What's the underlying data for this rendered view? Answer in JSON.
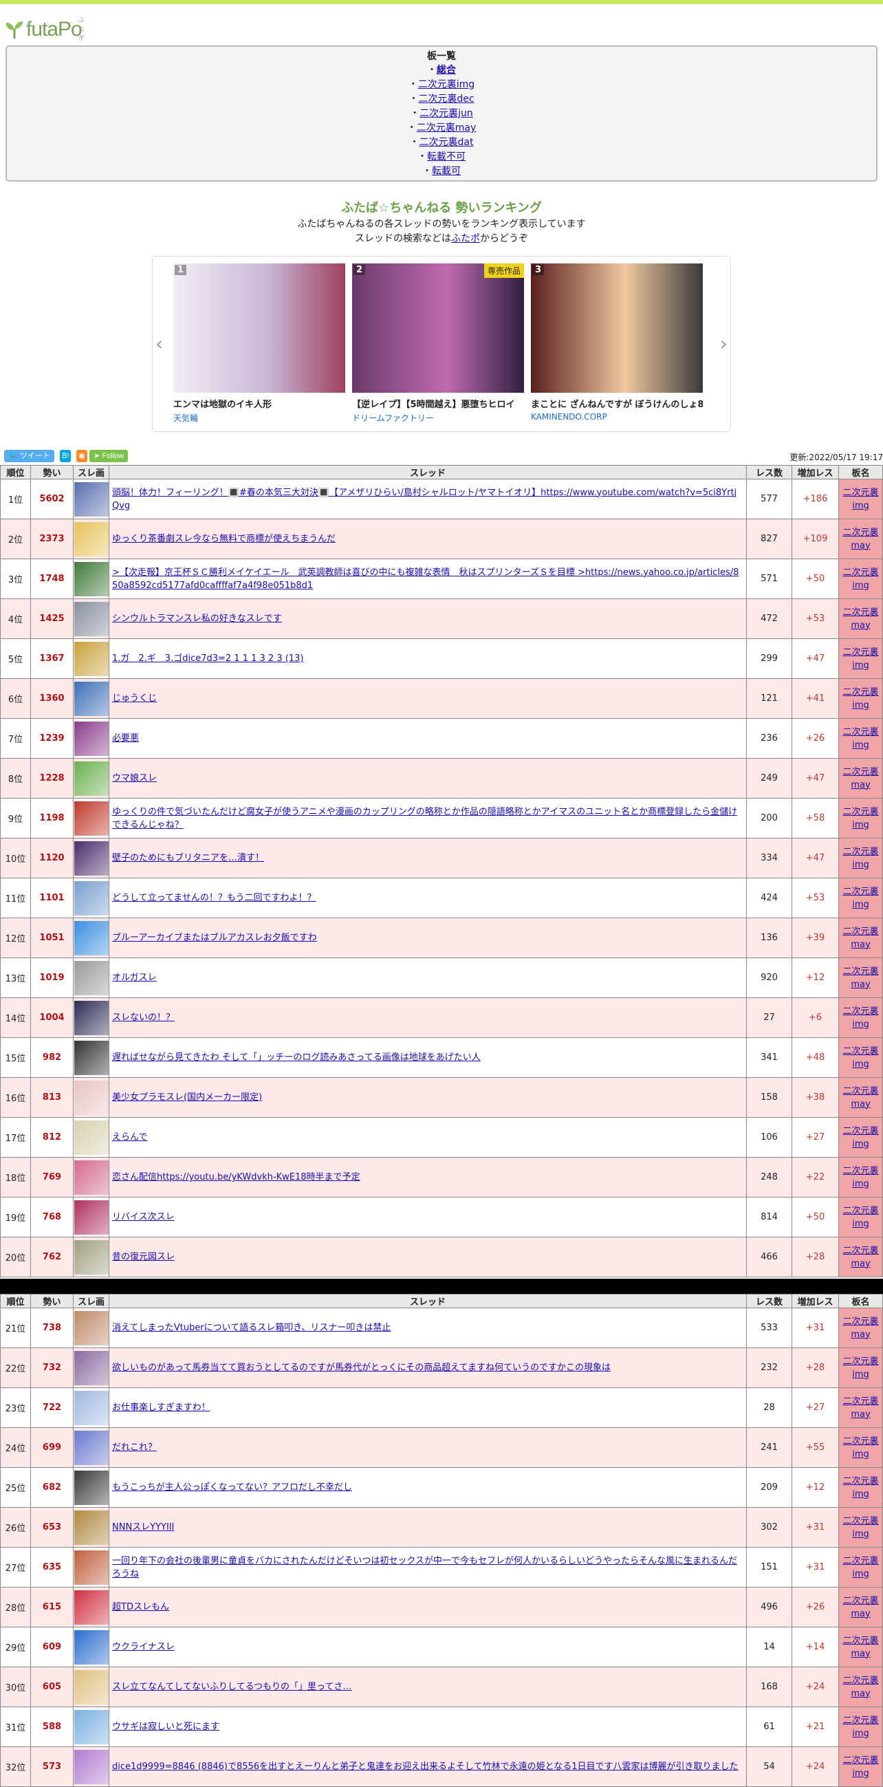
{
  "logo": {
    "text": "futaPo",
    "small": "ふたポ"
  },
  "boards": {
    "title": "板一覧",
    "items": [
      {
        "label": "総合",
        "selected": true
      },
      {
        "label": "二次元裏img"
      },
      {
        "label": "二次元裏dec"
      },
      {
        "label": "二次元裏jun"
      },
      {
        "label": "二次元裏may"
      },
      {
        "label": "二次元裏dat"
      },
      {
        "label": "転載不可"
      },
      {
        "label": "転載可"
      }
    ]
  },
  "ranking": {
    "title": "ふたば☆ちゃんねる 勢いランキング",
    "desc1": "ふたばちゃんねるの各スレッドの勢いをランキング表示しています",
    "desc2_pre": "スレッドの検索などは",
    "desc2_link": "ふたポ",
    "desc2_post": "からどうぞ"
  },
  "carousel": {
    "items": [
      {
        "num": "1",
        "title": "エンマは地獄のイキ人形",
        "author": "天気輪",
        "badge": ""
      },
      {
        "num": "2",
        "title": "【逆レイプ】【5時間越え】悪堕ちヒロイ",
        "author": "ドリームファクトリー",
        "badge": "専売作品"
      },
      {
        "num": "3",
        "title": "まことに ざんねんですが ぼうけんのしょ8",
        "author": "KAMINENDO.CORP",
        "badge": ""
      }
    ]
  },
  "social": {
    "tweet": "ツイート",
    "hatena": "B!",
    "follow": "Follow",
    "updated": "更新:2022/05/17 19:17"
  },
  "table": {
    "headers": {
      "rank": "順位",
      "ikioi": "勢い",
      "thumb": "スレ画",
      "thread": "スレッド",
      "res": "レス数",
      "inc": "増加レス",
      "board": "板名"
    },
    "rows1": [
      {
        "rank": "1位",
        "ikioi": "5602",
        "title": "頭脳！体力！フィーリング！🔳#春の本気三大対決🔳【アメザリひらい/島村シャルロット/ヤマトイオリ】https://www.youtube.com/watch?v=5ci8YrtjQvg",
        "res": "577",
        "inc": "+186",
        "b1": "二次元裏",
        "b2": "img",
        "color": "#5a6fb0"
      },
      {
        "rank": "2位",
        "ikioi": "2373",
        "title": "ゆっくり茶番劇スレ今なら無料で商標が使えちまうんだ",
        "res": "827",
        "inc": "+109",
        "b1": "二次元裏",
        "b2": "may",
        "color": "#e6c35a"
      },
      {
        "rank": "3位",
        "ikioi": "1748",
        "title": ">【次走報】京王杯ＳＣ勝利メイケイエール　武英調教師は喜びの中にも複雑な表情　秋はスプリンターズＳを目標 >https://news.yahoo.co.jp/articles/850a8592cd5177afd0caffffaf7a4f98e051b8d1",
        "res": "571",
        "inc": "+50",
        "b1": "二次元裏",
        "b2": "img",
        "color": "#3f7a3a"
      },
      {
        "rank": "4位",
        "ikioi": "1425",
        "title": "シンウルトラマンスレ私の好きなスレです",
        "res": "472",
        "inc": "+53",
        "b1": "二次元裏",
        "b2": "may",
        "color": "#8a8fa0"
      },
      {
        "rank": "5位",
        "ikioi": "1367",
        "title": "1.ガ　2.ギ　3.ゴdice7d3=2 1 1 1 3 2 3 (13)",
        "res": "299",
        "inc": "+47",
        "b1": "二次元裏",
        "b2": "img",
        "color": "#c9a23c"
      },
      {
        "rank": "6位",
        "ikioi": "1360",
        "title": "じゅうくじ",
        "res": "121",
        "inc": "+41",
        "b1": "二次元裏",
        "b2": "img",
        "color": "#3d6fb8"
      },
      {
        "rank": "7位",
        "ikioi": "1239",
        "title": "必要悪",
        "res": "236",
        "inc": "+26",
        "b1": "二次元裏",
        "b2": "img",
        "color": "#8a3d8a"
      },
      {
        "rank": "8位",
        "ikioi": "1228",
        "title": "ウマ娘スレ",
        "res": "249",
        "inc": "+47",
        "b1": "二次元裏",
        "b2": "may",
        "color": "#6ab04c"
      },
      {
        "rank": "9位",
        "ikioi": "1198",
        "title": "ゆっくりの件で気づいたんだけど腐女子が使うアニメや漫画のカップリングの略称とか作品の隠語略称とかアイマスのユニット名とか商標登録したら金儲けできるんじゃね？",
        "res": "200",
        "inc": "+58",
        "b1": "二次元裏",
        "b2": "img",
        "color": "#c0392b"
      },
      {
        "rank": "10位",
        "ikioi": "1120",
        "title": "壁子のためにもブリタニアを…潰す！",
        "res": "334",
        "inc": "+47",
        "b1": "二次元裏",
        "b2": "img",
        "color": "#4b2c6b"
      },
      {
        "rank": "11位",
        "ikioi": "1101",
        "title": "どうして立ってませんの！？もう二回ですわよ！？",
        "res": "424",
        "inc": "+53",
        "b1": "二次元裏",
        "b2": "img",
        "color": "#7a9fd0"
      },
      {
        "rank": "12位",
        "ikioi": "1051",
        "title": "ブルーアーカイブまたはブルアカスレお夕飯ですわ",
        "res": "136",
        "inc": "+39",
        "b1": "二次元裏",
        "b2": "may",
        "color": "#3a8fe0"
      },
      {
        "rank": "13位",
        "ikioi": "1019",
        "title": "オルガスレ",
        "res": "920",
        "inc": "+12",
        "b1": "二次元裏",
        "b2": "may",
        "color": "#9a9a9a"
      },
      {
        "rank": "14位",
        "ikioi": "1004",
        "title": "スレないの！？",
        "res": "27",
        "inc": "+6",
        "b1": "二次元裏",
        "b2": "img",
        "color": "#2c2c54"
      },
      {
        "rank": "15位",
        "ikioi": "982",
        "title": "遅ればせながら見てきたわ そして「」ッチーのログ読みあさってる画像は地球をあげたい人",
        "res": "341",
        "inc": "+48",
        "b1": "二次元裏",
        "b2": "img",
        "color": "#333333"
      },
      {
        "rank": "16位",
        "ikioi": "813",
        "title": "美少女プラモスレ(国内メーカー限定)",
        "res": "158",
        "inc": "+38",
        "b1": "二次元裏",
        "b2": "may",
        "color": "#e8c4c4"
      },
      {
        "rank": "17位",
        "ikioi": "812",
        "title": "えらんで",
        "res": "106",
        "inc": "+27",
        "b1": "二次元裏",
        "b2": "img",
        "color": "#d8d0b0"
      },
      {
        "rank": "18位",
        "ikioi": "769",
        "title": "恋さん配信https://youtu.be/yKWdvkh-KwE18時半まで予定",
        "res": "248",
        "inc": "+22",
        "b1": "二次元裏",
        "b2": "img",
        "color": "#d46a8c"
      },
      {
        "rank": "19位",
        "ikioi": "768",
        "title": "リバイス次スレ",
        "res": "814",
        "inc": "+50",
        "b1": "二次元裏",
        "b2": "img",
        "color": "#b03060"
      },
      {
        "rank": "20位",
        "ikioi": "762",
        "title": "昔の復元図スレ",
        "res": "466",
        "inc": "+28",
        "b1": "二次元裏",
        "b2": "may",
        "color": "#a0a080"
      }
    ],
    "rows2": [
      {
        "rank": "21位",
        "ikioi": "738",
        "title": "消えてしまったVtuberについて語るスレ箱叩き、リスナー叩きは禁止",
        "res": "533",
        "inc": "+31",
        "b1": "二次元裏",
        "b2": "may",
        "color": "#c08a6a"
      },
      {
        "rank": "22位",
        "ikioi": "732",
        "title": "欲しいものがあって馬券当てて買おうとしてるのですが馬券代がとっくにその商品超えてますね何ていうのですかこの現象は",
        "res": "232",
        "inc": "+28",
        "b1": "二次元裏",
        "b2": "img",
        "color": "#8a6aa0"
      },
      {
        "rank": "23位",
        "ikioi": "722",
        "title": "お仕事楽しすぎますわ！",
        "res": "28",
        "inc": "+27",
        "b1": "二次元裏",
        "b2": "may",
        "color": "#a0b8e0"
      },
      {
        "rank": "24位",
        "ikioi": "699",
        "title": "だれこれ？",
        "res": "241",
        "inc": "+55",
        "b1": "二次元裏",
        "b2": "img",
        "color": "#6a7ad0"
      },
      {
        "rank": "25位",
        "ikioi": "682",
        "title": "もうこっちが主人公っぽくなってない？アフロだし不幸だし",
        "res": "209",
        "inc": "+12",
        "b1": "二次元裏",
        "b2": "img",
        "color": "#3a3a3a"
      },
      {
        "rank": "26位",
        "ikioi": "653",
        "title": "NNNスレYYYIII",
        "res": "302",
        "inc": "+31",
        "b1": "二次元裏",
        "b2": "img",
        "color": "#b08a40"
      },
      {
        "rank": "27位",
        "ikioi": "635",
        "title": "一回り年下の会社の後輩男に童貞をバカにされたんだけどそいつは初セックスが中一で今もセフレが何人かいるらしいどうやったらそんな風に生まれるんだろうね",
        "res": "151",
        "inc": "+31",
        "b1": "二次元裏",
        "b2": "img",
        "color": "#c06040"
      },
      {
        "rank": "28位",
        "ikioi": "615",
        "title": "超TDスレもん",
        "res": "496",
        "inc": "+26",
        "b1": "二次元裏",
        "b2": "may",
        "color": "#d03040"
      },
      {
        "rank": "29位",
        "ikioi": "609",
        "title": "ウクライナスレ",
        "res": "14",
        "inc": "+14",
        "b1": "二次元裏",
        "b2": "may",
        "color": "#2b6cd0"
      },
      {
        "rank": "30位",
        "ikioi": "605",
        "title": "スレ立てなんてしてないふりしてるつもりの「」里ってさ…",
        "res": "168",
        "inc": "+24",
        "b1": "二次元裏",
        "b2": "may",
        "color": "#e0c080"
      },
      {
        "rank": "31位",
        "ikioi": "588",
        "title": "ウサギは寂しいと死にます",
        "res": "61",
        "inc": "+21",
        "b1": "二次元裏",
        "b2": "img",
        "color": "#7ab0e0"
      },
      {
        "rank": "32位",
        "ikioi": "573",
        "title": "dice1d9999=8846 (8846)で8556を出すとえーりんと弟子と鬼達をお迎え出来るよそして竹林で永遠の姫となる1日目です八雲家は博麗が引き取りました",
        "res": "54",
        "inc": "+24",
        "b1": "二次元裏",
        "b2": "img",
        "color": "#b07ad0"
      }
    ]
  }
}
